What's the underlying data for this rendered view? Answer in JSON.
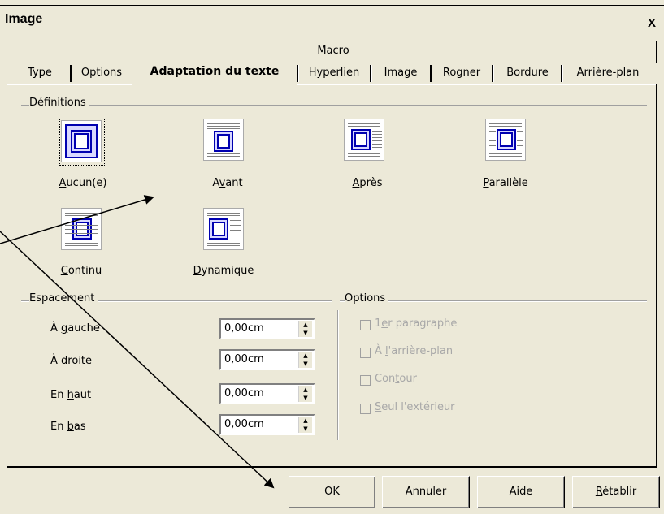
{
  "dialog": {
    "title": "Image",
    "close_label": "X"
  },
  "tabs": {
    "row1": [
      "Macro"
    ],
    "row2": [
      "Type",
      "Options",
      "Adaptation du texte",
      "Hyperlien",
      "Image",
      "Rogner",
      "Bordure",
      "Arrière-plan"
    ],
    "selected": "Adaptation du texte"
  },
  "definitions": {
    "label": "Définitions",
    "items": [
      {
        "label": "Aucun(e)",
        "icon": "wrap-none-icon"
      },
      {
        "label": "Avant",
        "icon": "wrap-before-icon"
      },
      {
        "label": "Après",
        "icon": "wrap-after-icon"
      },
      {
        "label": "Parallèle",
        "icon": "wrap-parallel-icon"
      },
      {
        "label": "Continu",
        "icon": "wrap-through-icon"
      },
      {
        "label": "Dynamique",
        "icon": "wrap-dynamic-icon"
      }
    ]
  },
  "spacing": {
    "label": "Espacement",
    "fields": [
      {
        "label": "À gauche",
        "value": "0,00cm"
      },
      {
        "label": "À droite",
        "value": "0,00cm"
      },
      {
        "label": "En haut",
        "value": "0,00cm"
      },
      {
        "label": "En bas",
        "value": "0,00cm"
      }
    ]
  },
  "options": {
    "label": "Options",
    "items": [
      {
        "label": "1er paragraphe",
        "checked": false,
        "enabled": false
      },
      {
        "label": "À l'arrière-plan",
        "checked": false,
        "enabled": false
      },
      {
        "label": "Contour",
        "checked": false,
        "enabled": false
      },
      {
        "label": "Seul l'extérieur",
        "checked": false,
        "enabled": false
      }
    ]
  },
  "buttons": {
    "ok": "OK",
    "cancel": "Annuler",
    "help": "Aide",
    "reset": "Rétablir"
  }
}
